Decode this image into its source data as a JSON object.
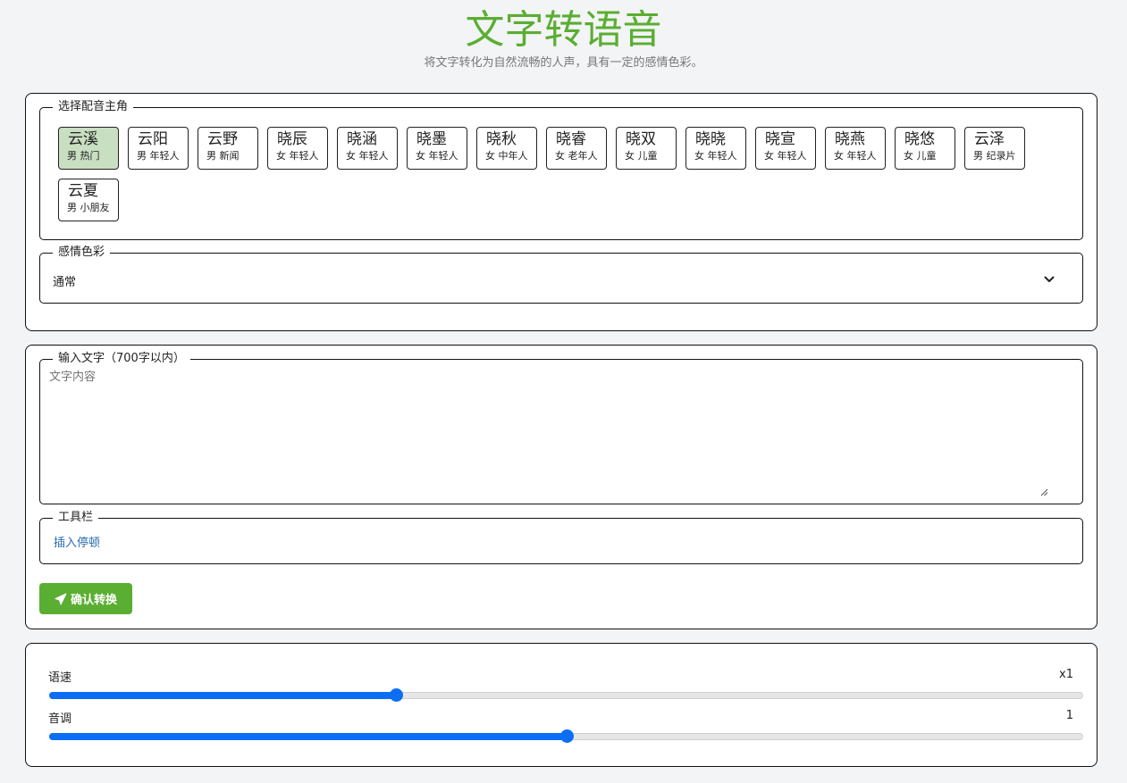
{
  "header": {
    "title": "文字转语音",
    "subtitle": "将文字转化为自然流畅的人声，具有一定的感情色彩。"
  },
  "voice_section": {
    "legend": "选择配音主角",
    "voices": [
      {
        "name": "云溪",
        "desc": "男 热门",
        "selected": true
      },
      {
        "name": "云阳",
        "desc": "男 年轻人"
      },
      {
        "name": "云野",
        "desc": "男 新闻"
      },
      {
        "name": "晓辰",
        "desc": "女 年轻人"
      },
      {
        "name": "晓涵",
        "desc": "女 年轻人"
      },
      {
        "name": "晓墨",
        "desc": "女 年轻人"
      },
      {
        "name": "晓秋",
        "desc": "女 中年人"
      },
      {
        "name": "晓睿",
        "desc": "女 老年人"
      },
      {
        "name": "晓双",
        "desc": "女 儿童"
      },
      {
        "name": "晓晓",
        "desc": "女 年轻人"
      },
      {
        "name": "晓宣",
        "desc": "女 年轻人"
      },
      {
        "name": "晓燕",
        "desc": "女 年轻人"
      },
      {
        "name": "晓悠",
        "desc": "女 儿童"
      },
      {
        "name": "云泽",
        "desc": "男 纪录片"
      },
      {
        "name": "云夏",
        "desc": "男 小朋友"
      }
    ],
    "emotion_legend": "感情色彩",
    "emotion_value": "通常"
  },
  "input_section": {
    "legend": "输入文字（700字以内）",
    "placeholder": "文字内容",
    "toolbar_legend": "工具栏",
    "insert_pause": "插入停顿",
    "confirm_label": "确认转换"
  },
  "controls": {
    "speed_label": "语速",
    "speed_value": "x1",
    "speed_fraction": 0.335,
    "pitch_label": "音调",
    "pitch_value": "1",
    "pitch_fraction": 0.5
  },
  "colors": {
    "accent_green": "#5aae32",
    "selected_voice_bg": "#c9dfc1",
    "slider_blue": "#0b6ef5",
    "link_blue": "#2a6db0"
  }
}
